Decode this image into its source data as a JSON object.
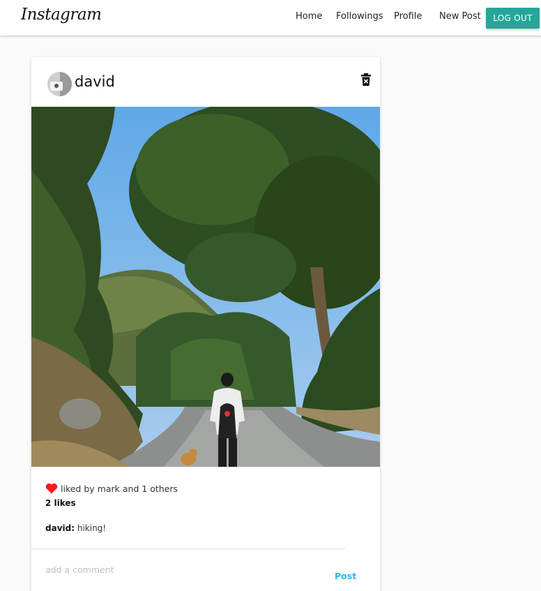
{
  "navbar": {
    "brand": "Instagram",
    "links": [
      "Home",
      "Followings",
      "Profile",
      "New Post"
    ],
    "logout_label": "LOG OUT"
  },
  "post": {
    "username": "david",
    "liked_by_text": "liked by mark and 1 others",
    "likes_count": "2 likes",
    "caption_user": "david:",
    "caption_text": "hiking!",
    "comment_placeholder": "add a comment",
    "post_label": "Post"
  },
  "colors": {
    "accent": "#26a69a",
    "post_button": "#29b6f6",
    "heart": "#ff1a1a"
  }
}
